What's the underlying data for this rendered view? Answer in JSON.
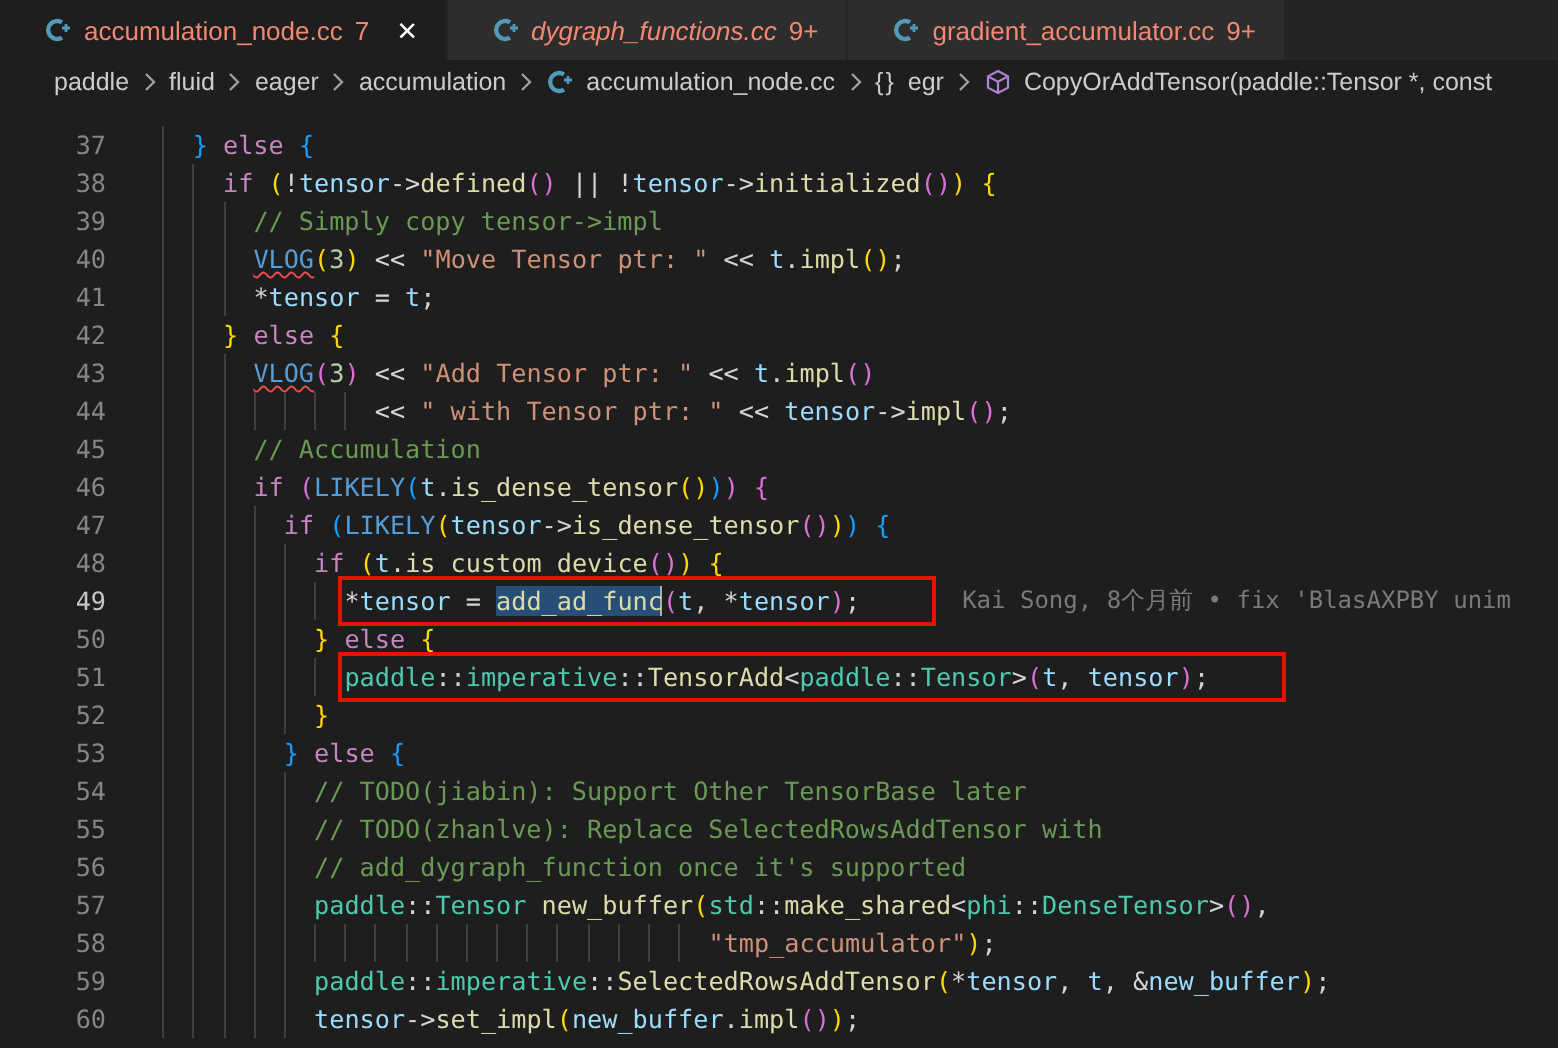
{
  "tabs": [
    {
      "label": "accumulation_node.cc",
      "count": "7",
      "selected": true,
      "preview": false,
      "close": "×"
    },
    {
      "label": "dygraph_functions.cc",
      "count": "9+",
      "selected": false,
      "preview": true
    },
    {
      "label": "gradient_accumulator.cc",
      "count": "9+",
      "selected": false,
      "preview": false
    }
  ],
  "breadcrumb": [
    {
      "kind": "folder",
      "text": "paddle"
    },
    {
      "kind": "folder",
      "text": "fluid"
    },
    {
      "kind": "folder",
      "text": "eager"
    },
    {
      "kind": "folder",
      "text": "accumulation"
    },
    {
      "kind": "file",
      "text": "accumulation_node.cc"
    },
    {
      "kind": "namespace",
      "symbol": "{}",
      "text": "egr"
    },
    {
      "kind": "function",
      "text": "CopyOrAddTensor(paddle::Tensor *, const"
    }
  ],
  "lines": [
    {
      "number": "37",
      "tokens": [
        {
          "kind": "b3",
          "text": "    }"
        },
        {
          "kind": "kw",
          "text": " else "
        },
        {
          "kind": "b3",
          "text": "{"
        }
      ]
    },
    {
      "number": "38",
      "tokens": [
        {
          "kind": "kw",
          "text": "      if "
        },
        {
          "kind": "b1",
          "text": "("
        },
        {
          "kind": "op",
          "text": "!"
        },
        {
          "kind": "var",
          "text": "tensor"
        },
        {
          "kind": "op",
          "text": "->"
        },
        {
          "kind": "fn",
          "text": "defined"
        },
        {
          "kind": "b2",
          "text": "()"
        },
        {
          "kind": "op",
          "text": " || !"
        },
        {
          "kind": "var",
          "text": "tensor"
        },
        {
          "kind": "op",
          "text": "->"
        },
        {
          "kind": "fn",
          "text": "initialized"
        },
        {
          "kind": "b2",
          "text": "()"
        },
        {
          "kind": "b1",
          "text": ") {"
        }
      ]
    },
    {
      "number": "39",
      "tokens": [
        {
          "kind": "cm",
          "text": "        // Simply copy tensor->impl"
        }
      ]
    },
    {
      "number": "40",
      "tokens": [
        {
          "kind": "mac",
          "text": "        VLOG",
          "squiggle": true
        },
        {
          "kind": "b1",
          "text": "("
        },
        {
          "kind": "num",
          "text": "3"
        },
        {
          "kind": "b1",
          "text": ")"
        },
        {
          "kind": "op",
          "text": " << "
        },
        {
          "kind": "str",
          "text": "\"Move Tensor ptr: \""
        },
        {
          "kind": "op",
          "text": " << "
        },
        {
          "kind": "var",
          "text": "t"
        },
        {
          "kind": "op",
          "text": "."
        },
        {
          "kind": "fn",
          "text": "impl"
        },
        {
          "kind": "b1",
          "text": "()"
        },
        {
          "kind": "op",
          "text": ";"
        }
      ]
    },
    {
      "number": "41",
      "tokens": [
        {
          "kind": "op",
          "text": "        *"
        },
        {
          "kind": "var",
          "text": "tensor"
        },
        {
          "kind": "op",
          "text": " = "
        },
        {
          "kind": "var",
          "text": "t"
        },
        {
          "kind": "op",
          "text": ";"
        }
      ]
    },
    {
      "number": "42",
      "tokens": [
        {
          "kind": "b1",
          "text": "      }"
        },
        {
          "kind": "kw",
          "text": " else "
        },
        {
          "kind": "b1",
          "text": "{"
        }
      ]
    },
    {
      "number": "43",
      "tokens": [
        {
          "kind": "mac",
          "text": "        VLOG",
          "squiggle": true
        },
        {
          "kind": "b2",
          "text": "("
        },
        {
          "kind": "num",
          "text": "3"
        },
        {
          "kind": "b2",
          "text": ")"
        },
        {
          "kind": "op",
          "text": " << "
        },
        {
          "kind": "str",
          "text": "\"Add Tensor ptr: \""
        },
        {
          "kind": "op",
          "text": " << "
        },
        {
          "kind": "var",
          "text": "t"
        },
        {
          "kind": "op",
          "text": "."
        },
        {
          "kind": "fn",
          "text": "impl"
        },
        {
          "kind": "b2",
          "text": "()"
        }
      ]
    },
    {
      "number": "44",
      "tokens": [
        {
          "kind": "op",
          "text": "                << "
        },
        {
          "kind": "str",
          "text": "\" with Tensor ptr: \""
        },
        {
          "kind": "op",
          "text": " << "
        },
        {
          "kind": "var",
          "text": "tensor"
        },
        {
          "kind": "op",
          "text": "->"
        },
        {
          "kind": "fn",
          "text": "impl"
        },
        {
          "kind": "b2",
          "text": "()"
        },
        {
          "kind": "op",
          "text": ";"
        }
      ]
    },
    {
      "number": "45",
      "tokens": [
        {
          "kind": "cm",
          "text": "        // Accumulation"
        }
      ]
    },
    {
      "number": "46",
      "tokens": [
        {
          "kind": "kw",
          "text": "        if "
        },
        {
          "kind": "b2",
          "text": "("
        },
        {
          "kind": "mac",
          "text": "LIKELY"
        },
        {
          "kind": "b3",
          "text": "("
        },
        {
          "kind": "var",
          "text": "t"
        },
        {
          "kind": "op",
          "text": "."
        },
        {
          "kind": "fn",
          "text": "is_dense_tensor"
        },
        {
          "kind": "b1",
          "text": "()"
        },
        {
          "kind": "b3",
          "text": ")"
        },
        {
          "kind": "b2",
          "text": ") {"
        }
      ]
    },
    {
      "number": "47",
      "tokens": [
        {
          "kind": "kw",
          "text": "          if "
        },
        {
          "kind": "b3",
          "text": "("
        },
        {
          "kind": "mac",
          "text": "LIKELY"
        },
        {
          "kind": "b1",
          "text": "("
        },
        {
          "kind": "var",
          "text": "tensor"
        },
        {
          "kind": "op",
          "text": "->"
        },
        {
          "kind": "fn",
          "text": "is_dense_tensor"
        },
        {
          "kind": "b2",
          "text": "()"
        },
        {
          "kind": "b1",
          "text": ")"
        },
        {
          "kind": "b3",
          "text": ") {"
        }
      ]
    },
    {
      "number": "48",
      "tokens": [
        {
          "kind": "kw",
          "text": "            if "
        },
        {
          "kind": "b1",
          "text": "("
        },
        {
          "kind": "var",
          "text": "t"
        },
        {
          "kind": "op",
          "text": "."
        },
        {
          "kind": "fn",
          "text": "is custom device"
        },
        {
          "kind": "b2",
          "text": "()"
        },
        {
          "kind": "b1",
          "text": ") {"
        }
      ]
    },
    {
      "number": "49",
      "current": true,
      "boxed": true,
      "blame": "Kai Song, 8个月前 • fix 'BlasAXPBY unim",
      "tokens": [
        {
          "kind": "op",
          "text": "              *"
        },
        {
          "kind": "var",
          "text": "tensor"
        },
        {
          "kind": "op",
          "text": " = "
        },
        {
          "kind": "fn",
          "text": "add_ad_func",
          "selected": true
        },
        {
          "kind": "b2",
          "text": "("
        },
        {
          "kind": "var",
          "text": "t"
        },
        {
          "kind": "op",
          "text": ", *"
        },
        {
          "kind": "var",
          "text": "tensor"
        },
        {
          "kind": "b2",
          "text": ")"
        },
        {
          "kind": "op",
          "text": ";"
        }
      ]
    },
    {
      "number": "50",
      "tokens": [
        {
          "kind": "b1",
          "text": "            }"
        },
        {
          "kind": "kw",
          "text": " else "
        },
        {
          "kind": "b1",
          "text": "{"
        }
      ]
    },
    {
      "number": "51",
      "boxed": true,
      "tokens": [
        {
          "kind": "type",
          "text": "              paddle"
        },
        {
          "kind": "op",
          "text": "::"
        },
        {
          "kind": "type",
          "text": "imperative"
        },
        {
          "kind": "op",
          "text": "::"
        },
        {
          "kind": "fn",
          "text": "TensorAdd"
        },
        {
          "kind": "op",
          "text": "<"
        },
        {
          "kind": "type",
          "text": "paddle"
        },
        {
          "kind": "op",
          "text": "::"
        },
        {
          "kind": "type",
          "text": "Tensor"
        },
        {
          "kind": "op",
          "text": ">"
        },
        {
          "kind": "b2",
          "text": "("
        },
        {
          "kind": "var",
          "text": "t"
        },
        {
          "kind": "op",
          "text": ", "
        },
        {
          "kind": "var",
          "text": "tensor"
        },
        {
          "kind": "b2",
          "text": ")"
        },
        {
          "kind": "op",
          "text": ";"
        }
      ]
    },
    {
      "number": "52",
      "tokens": [
        {
          "kind": "b1",
          "text": "            }"
        }
      ]
    },
    {
      "number": "53",
      "tokens": [
        {
          "kind": "b3",
          "text": "          }"
        },
        {
          "kind": "kw",
          "text": " else "
        },
        {
          "kind": "b3",
          "text": "{"
        }
      ]
    },
    {
      "number": "54",
      "tokens": [
        {
          "kind": "cm",
          "text": "            // TODO(jiabin): Support Other TensorBase later"
        }
      ]
    },
    {
      "number": "55",
      "tokens": [
        {
          "kind": "cm",
          "text": "            // TODO(zhanlve): Replace SelectedRowsAddTensor with"
        }
      ]
    },
    {
      "number": "56",
      "tokens": [
        {
          "kind": "cm",
          "text": "            // add_dygraph_function once it's supported"
        }
      ]
    },
    {
      "number": "57",
      "tokens": [
        {
          "kind": "type",
          "text": "            paddle"
        },
        {
          "kind": "op",
          "text": "::"
        },
        {
          "kind": "type",
          "text": "Tensor"
        },
        {
          "kind": "fn",
          "text": " new_buffer"
        },
        {
          "kind": "b1",
          "text": "("
        },
        {
          "kind": "type",
          "text": "std"
        },
        {
          "kind": "op",
          "text": "::"
        },
        {
          "kind": "fn",
          "text": "make_shared"
        },
        {
          "kind": "op",
          "text": "<"
        },
        {
          "kind": "type",
          "text": "phi"
        },
        {
          "kind": "op",
          "text": "::"
        },
        {
          "kind": "type",
          "text": "DenseTensor"
        },
        {
          "kind": "op",
          "text": ">"
        },
        {
          "kind": "b2",
          "text": "()"
        },
        {
          "kind": "op",
          "text": ","
        }
      ]
    },
    {
      "number": "58",
      "tokens": [
        {
          "kind": "str",
          "text": "                                      \"tmp_accumulator\""
        },
        {
          "kind": "b1",
          "text": ")"
        },
        {
          "kind": "op",
          "text": ";"
        }
      ]
    },
    {
      "number": "59",
      "tokens": [
        {
          "kind": "type",
          "text": "            paddle"
        },
        {
          "kind": "op",
          "text": "::"
        },
        {
          "kind": "type",
          "text": "imperative"
        },
        {
          "kind": "op",
          "text": "::"
        },
        {
          "kind": "fn",
          "text": "SelectedRowsAddTensor"
        },
        {
          "kind": "b1",
          "text": "("
        },
        {
          "kind": "op",
          "text": "*"
        },
        {
          "kind": "var",
          "text": "tensor"
        },
        {
          "kind": "op",
          "text": ", "
        },
        {
          "kind": "var",
          "text": "t"
        },
        {
          "kind": "op",
          "text": ", &"
        },
        {
          "kind": "var",
          "text": "new_buffer"
        },
        {
          "kind": "b1",
          "text": ")"
        },
        {
          "kind": "op",
          "text": ";"
        }
      ]
    },
    {
      "number": "60",
      "tokens": [
        {
          "kind": "var",
          "text": "            tensor"
        },
        {
          "kind": "op",
          "text": "->"
        },
        {
          "kind": "fn",
          "text": "set_impl"
        },
        {
          "kind": "b1",
          "text": "("
        },
        {
          "kind": "var",
          "text": "new_buffer"
        },
        {
          "kind": "op",
          "text": "."
        },
        {
          "kind": "fn",
          "text": "impl"
        },
        {
          "kind": "b2",
          "text": "()"
        },
        {
          "kind": "b1",
          "text": ")"
        },
        {
          "kind": "op",
          "text": ";"
        }
      ]
    }
  ]
}
